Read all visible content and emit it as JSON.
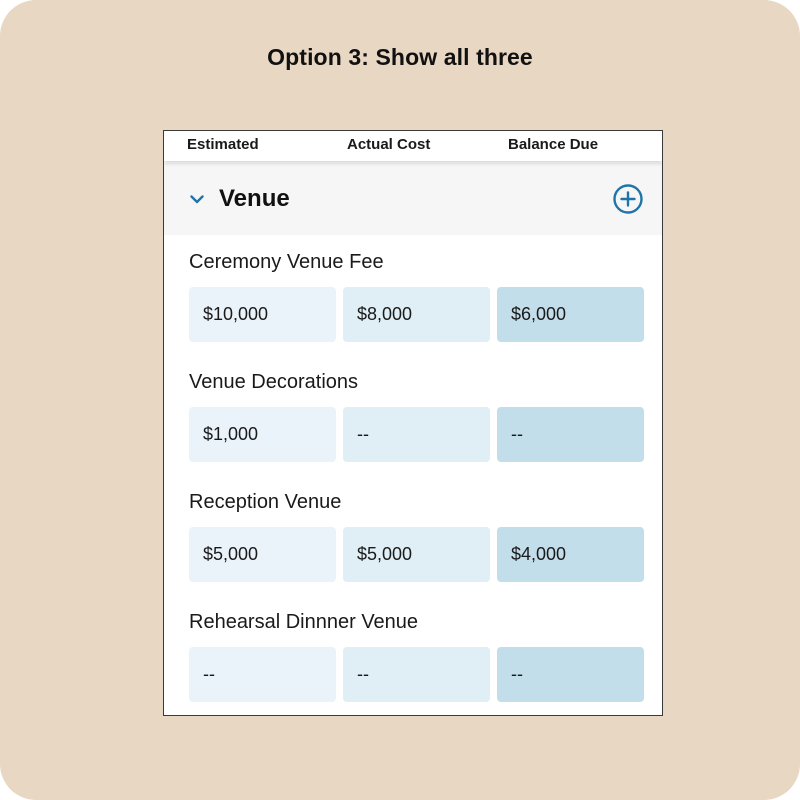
{
  "caption": "Option 3: Show all three",
  "columns": {
    "estimated": "Estimated",
    "actual": "Actual Cost",
    "balance": "Balance Due"
  },
  "section": {
    "title": "Venue",
    "expand_icon": "chevron-down-icon",
    "add_icon": "plus-circle-icon"
  },
  "colors": {
    "background": "#e8d7c2",
    "accent": "#1f75a8",
    "estimated_cell": "#eaf3fa",
    "actual_cell": "#e0eef5",
    "balance_cell": "#c3deeb"
  },
  "items": [
    {
      "label": "Ceremony Venue Fee",
      "estimated": "$10,000",
      "actual": "$8,000",
      "balance": "$6,000"
    },
    {
      "label": "Venue Decorations",
      "estimated": "$1,000",
      "actual": "--",
      "balance": "--"
    },
    {
      "label": "Reception Venue",
      "estimated": "$5,000",
      "actual": "$5,000",
      "balance": "$4,000"
    },
    {
      "label": "Rehearsal Dinnner Venue",
      "estimated": "--",
      "actual": "--",
      "balance": "--"
    }
  ]
}
